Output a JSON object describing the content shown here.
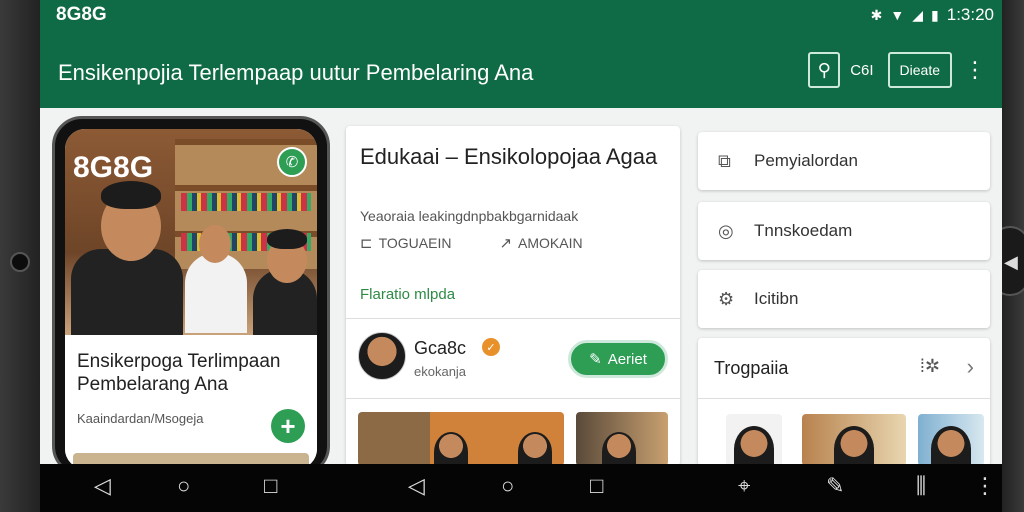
{
  "status": {
    "brand": "8G8G",
    "time": "1:3:20"
  },
  "appbar": {
    "title": "Ensikenpojia Terlempaap uutur Pembelaring Ana",
    "search_label": "C6I",
    "action_button": "Dieate"
  },
  "phone": {
    "brand": "8G8G",
    "card_title": "Ensikerpoga Terlimpaan Pembelarang Ana",
    "card_subtitle": "Kaaindardan/Msogeja"
  },
  "main_card": {
    "title": "Edukaai – Ensikolopojaa Agaa",
    "subtitle": "Yeaoraia leakingdnpbakbgarnidaak",
    "tag1": "TOGUAEIN",
    "tag2": "AMOKAIN",
    "link": "Flaratio mlpda",
    "author_name": "Gca8c",
    "author_handle": "ekokanja",
    "follow_label": "Aeriet"
  },
  "menu": {
    "item1": "Pemyialordan",
    "item2": "Tnnskoedam",
    "item3": "Icitibn"
  },
  "panel": {
    "title": "Trogpaiia"
  },
  "colors": {
    "brand_green": "#0f6b45",
    "accent_green": "#2e9e55",
    "badge_orange": "#e8912a"
  },
  "icons": [
    "bluetooth-icon",
    "wifi-icon",
    "signal-icon",
    "battery-icon",
    "search-icon",
    "more-vert-icon",
    "phone-icon",
    "plus-icon",
    "book-icon",
    "share-icon",
    "verified-icon",
    "edit-icon",
    "book-open-icon",
    "target-icon",
    "settings-icon",
    "filter-icon",
    "chevron-right-icon",
    "back-icon",
    "home-icon",
    "recents-icon",
    "cursor-icon",
    "pen-icon",
    "chart-icon"
  ]
}
